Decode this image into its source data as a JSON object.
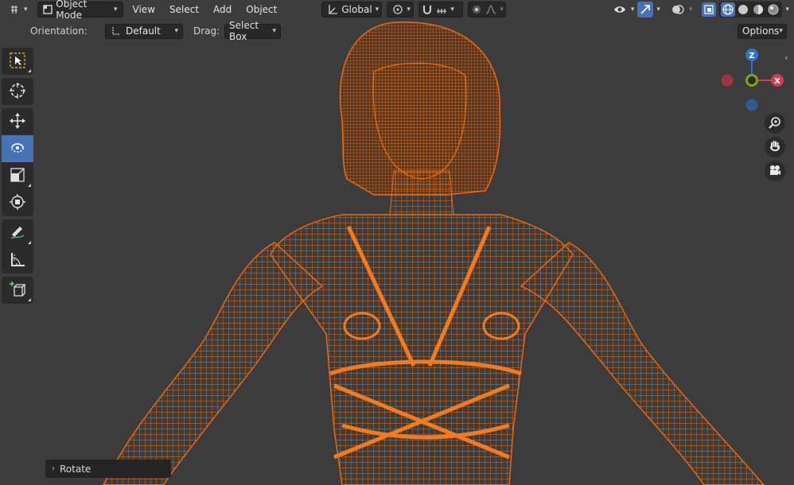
{
  "header": {
    "editor_type_icon": "3d-viewport-icon",
    "mode_label": "Object Mode",
    "menus": [
      "View",
      "Select",
      "Add",
      "Object"
    ],
    "orientation_label": "Global",
    "pivot_icon": "pivot-point-icon",
    "snap_icon": "magnet-icon",
    "proportional_icon": "proportional-edit-icon",
    "visibility_icon": "eye-icon",
    "gizmo_icon": "gizmo-toggle-icon",
    "overlay_icon": "overlay-icon",
    "xray_icon": "xray-icon",
    "shading_modes": [
      "wireframe",
      "solid",
      "material",
      "rendered"
    ],
    "active_shading": "wireframe"
  },
  "tool_settings": {
    "orientation_label": "Orientation:",
    "orientation_value": "Default",
    "drag_label": "Drag:",
    "drag_value": "Select Box",
    "options_label": "Options"
  },
  "toolbar": {
    "tools": [
      {
        "name": "select-box",
        "icon": "select-box-icon",
        "active": false
      },
      {
        "name": "cursor",
        "icon": "cursor-icon",
        "active": false
      },
      {
        "name": "move",
        "icon": "move-icon",
        "active": false
      },
      {
        "name": "rotate",
        "icon": "rotate-icon",
        "active": true
      },
      {
        "name": "scale",
        "icon": "scale-icon",
        "active": false
      },
      {
        "name": "transform",
        "icon": "transform-icon",
        "active": false
      },
      {
        "name": "annotate",
        "icon": "annotate-icon",
        "active": false
      },
      {
        "name": "measure",
        "icon": "measure-icon",
        "active": false
      },
      {
        "name": "add-cube",
        "icon": "add-cube-icon",
        "active": false
      }
    ]
  },
  "gizmo": {
    "axes": [
      "Z",
      "X"
    ],
    "colors": {
      "x": "#d63b52",
      "y": "#7ea51b",
      "z": "#2c76c9",
      "neg_x": "#9c3444",
      "neg_z": "#2e5c92"
    }
  },
  "nav_buttons": [
    "zoom-icon",
    "hand-pan-icon",
    "camera-icon"
  ],
  "last_operator": {
    "label": "Rotate"
  },
  "colors": {
    "background": "#3c3c3c",
    "selection": "#f06a10",
    "active_tool": "#4772b3"
  }
}
